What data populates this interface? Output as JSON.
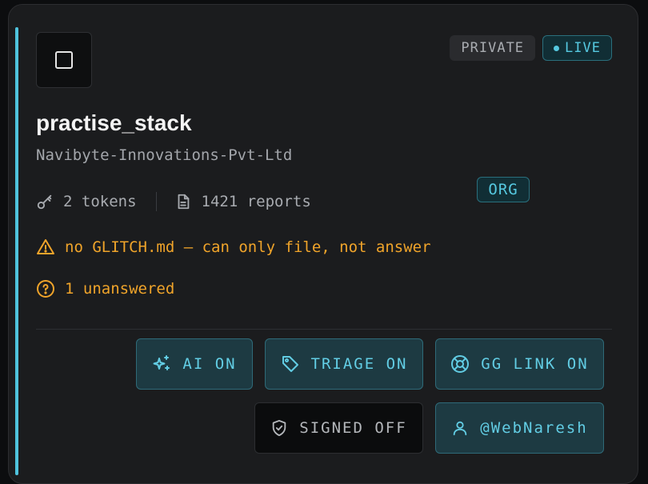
{
  "repo": {
    "name": "practise_stack",
    "org": "Navibyte-Innovations-Pvt-Ltd",
    "icon": "square-icon"
  },
  "badges": {
    "private": "PRIVATE",
    "org": "ORG",
    "live": "LIVE"
  },
  "stats": {
    "tokens": "2 tokens",
    "reports": "1421 reports"
  },
  "warnings": {
    "glitch": "no GLITCH.md — can only file, not answer",
    "unanswered": "1 unanswered"
  },
  "actions": {
    "ai": "AI ON",
    "triage": "TRIAGE ON",
    "gg_link": "GG LINK ON",
    "signed": "SIGNED OFF",
    "user": "@WebNaresh"
  },
  "colors": {
    "accent": "#4fc3dd",
    "warning": "#f0a42a",
    "card_bg": "#1b1c1e"
  }
}
